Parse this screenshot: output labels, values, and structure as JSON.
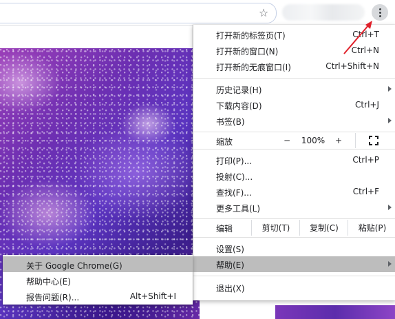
{
  "toolbar": {
    "bookmark_icon": "star-outline-icon",
    "menu_icon": "three-dot-vertical-icon"
  },
  "menu": {
    "new_tab": {
      "label": "打开新的标签页(T)",
      "shortcut": "Ctrl+T"
    },
    "new_window": {
      "label": "打开新的窗口(N)",
      "shortcut": "Ctrl+N"
    },
    "incognito": {
      "label": "打开新的无痕窗口(I)",
      "shortcut": "Ctrl+Shift+N"
    },
    "history": {
      "label": "历史记录(H)"
    },
    "downloads": {
      "label": "下载内容(D)",
      "shortcut": "Ctrl+J"
    },
    "bookmarks": {
      "label": "书签(B)"
    },
    "zoom": {
      "label": "缩放",
      "minus": "−",
      "value": "100%",
      "plus": "+",
      "fullscreen_icon": "fullscreen-icon"
    },
    "print": {
      "label": "打印(P)...",
      "shortcut": "Ctrl+P"
    },
    "cast": {
      "label": "投射(C)..."
    },
    "find": {
      "label": "查找(F)...",
      "shortcut": "Ctrl+F"
    },
    "more_tools": {
      "label": "更多工具(L)"
    },
    "edit": {
      "label": "编辑",
      "cut": "剪切(T)",
      "copy": "复制(C)",
      "paste": "粘贴(P)"
    },
    "settings": {
      "label": "设置(S)"
    },
    "help": {
      "label": "帮助(E)"
    },
    "exit": {
      "label": "退出(X)"
    }
  },
  "help_submenu": {
    "about": {
      "label": "关于 Google Chrome(G)"
    },
    "help_center": {
      "label": "帮助中心(E)"
    },
    "report_issue": {
      "label": "报告问题(R)...",
      "shortcut": "Alt+Shift+I"
    }
  },
  "colors": {
    "highlight": "#bdbdbd",
    "annotation_arrow": "#e0202a"
  }
}
